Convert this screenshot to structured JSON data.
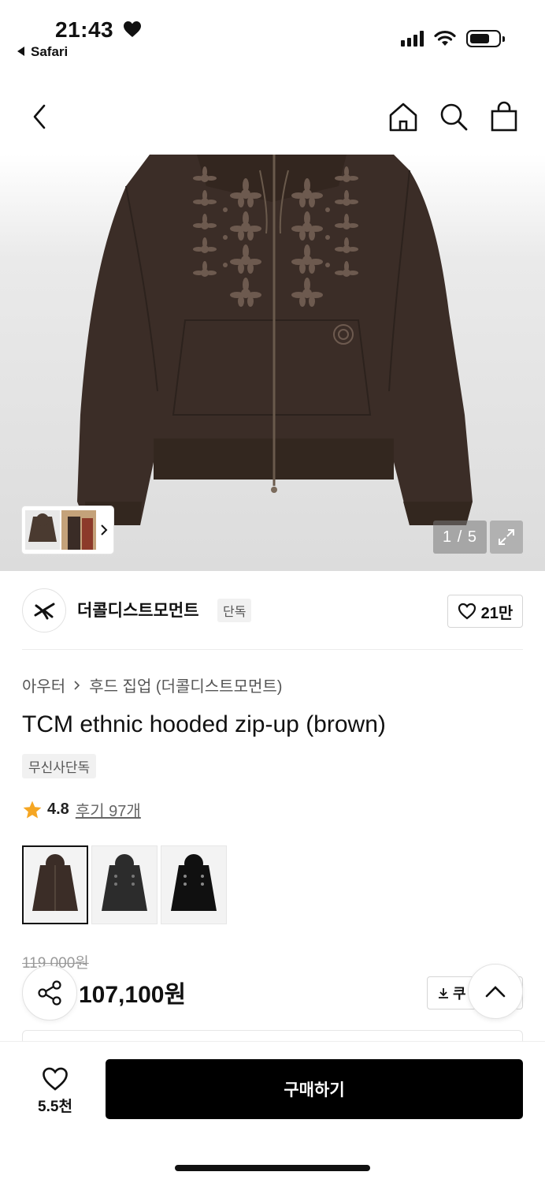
{
  "status_bar": {
    "time": "21:43",
    "back_app": "Safari"
  },
  "nav": {
    "icons": [
      "back-chevron-icon",
      "home-icon",
      "search-icon",
      "shopping-bag-icon"
    ]
  },
  "gallery": {
    "counter": "1 / 5",
    "current_index": 1,
    "total": 5,
    "garment_color": "#3b2d27"
  },
  "brand": {
    "name": "더콜디스트모먼트",
    "badge": "단독",
    "likes": "21만"
  },
  "product": {
    "breadcrumb_category": "아우터",
    "breadcrumb_sub": "후드 집업 (더콜디스트모먼트)",
    "title": "TCM ethnic hooded zip-up (brown)",
    "exclusive_badge": "무신사단독",
    "rating": "4.8",
    "reviews": "후기 97개",
    "color_options": [
      {
        "name": "brown",
        "color": "#3b2d27",
        "selected": true
      },
      {
        "name": "charcoal",
        "color": "#2c2c2c",
        "selected": false
      },
      {
        "name": "black",
        "color": "#101010",
        "selected": false
      }
    ],
    "original_price": "119,000원",
    "sale_price": "107,100원",
    "coupon_label": "쿠"
  },
  "bottom_bar": {
    "wish_count": "5.5천",
    "buy_label": "구매하기"
  },
  "colors": {
    "star": "#f5a623",
    "buy_button": "#000000"
  }
}
